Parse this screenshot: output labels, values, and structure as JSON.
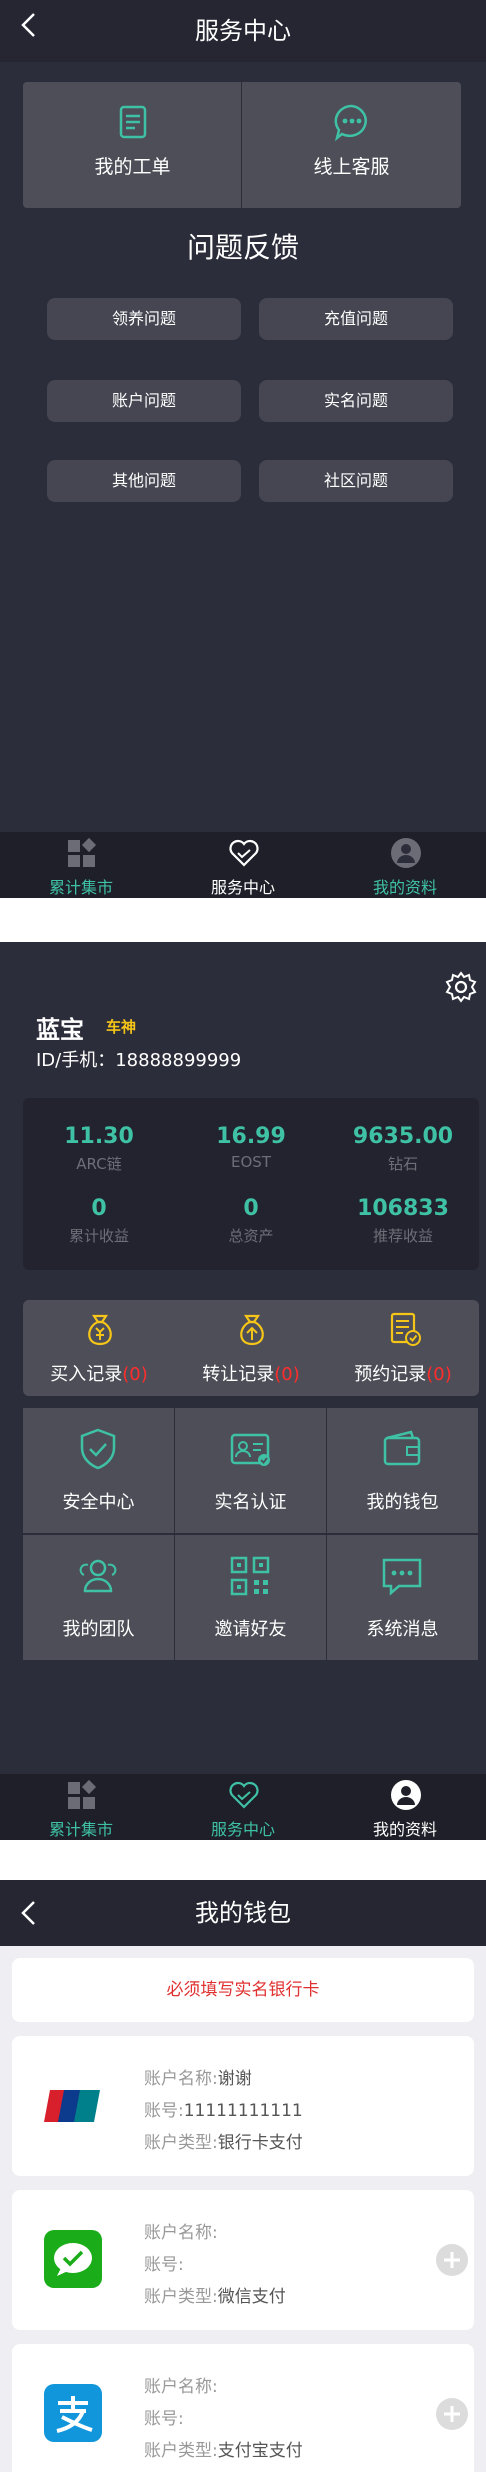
{
  "service_center": {
    "title": "服务中心",
    "quick_actions": [
      {
        "label": "我的工单",
        "icon": "ticket-icon"
      },
      {
        "label": "线上客服",
        "icon": "chat-bubble-icon"
      }
    ],
    "feedback_title": "问题反馈",
    "feedback_items": [
      "领养问题",
      "充值问题",
      "账户问题",
      "实名问题",
      "其他问题",
      "社区问题"
    ]
  },
  "tabbar": {
    "tabs": [
      {
        "label": "累计集市",
        "icon": "market-icon"
      },
      {
        "label": "服务中心",
        "icon": "heart-service-icon"
      },
      {
        "label": "我的资料",
        "icon": "user-icon"
      }
    ],
    "colors": {
      "active": "#ffffff",
      "inactive": "#3fc1a5"
    }
  },
  "profile": {
    "name": "蓝宝",
    "rank": "车神",
    "id_phone": "ID/手机：18888899999",
    "stats": [
      {
        "value": "11.30",
        "label": "ARC链"
      },
      {
        "value": "16.99",
        "label": "EOST"
      },
      {
        "value": "9635.00",
        "label": "钻石"
      },
      {
        "value": "0",
        "label": "累计收益"
      },
      {
        "value": "0",
        "label": "总资产"
      },
      {
        "value": "106833",
        "label": "推荐收益"
      }
    ],
    "records": [
      {
        "label": "买入记录",
        "count": "(0)",
        "icon": "money-bag-icon"
      },
      {
        "label": "转让记录",
        "count": "(0)",
        "icon": "money-bag-upload-icon"
      },
      {
        "label": "预约记录",
        "count": "(0)",
        "icon": "clipboard-check-icon"
      }
    ],
    "menu": [
      {
        "label": "安全中心",
        "icon": "shield-check-icon"
      },
      {
        "label": "实名认证",
        "icon": "id-card-icon"
      },
      {
        "label": "我的钱包",
        "icon": "wallet-icon"
      },
      {
        "label": "我的团队",
        "icon": "team-icon"
      },
      {
        "label": "邀请好友",
        "icon": "qr-code-icon"
      },
      {
        "label": "系统消息",
        "icon": "message-icon"
      }
    ],
    "accent_color": "#3fc1a5"
  },
  "wallet": {
    "title": "我的钱包",
    "notice": "必须填写实名银行卡",
    "accounts": [
      {
        "icon": "unionpay-logo",
        "name_label": "账户名称:",
        "name": "谢谢",
        "number_label": "账号:",
        "number": "11111111111",
        "type_label": "账户类型:",
        "type": "银行卡支付"
      },
      {
        "icon": "wechat-pay-logo",
        "name_label": "账户名称:",
        "name": "",
        "number_label": "账号:",
        "number": "",
        "type_label": "账户类型:",
        "type": "微信支付"
      },
      {
        "icon": "alipay-logo",
        "name_label": "账户名称:",
        "name": "",
        "number_label": "账号:",
        "number": "",
        "type_label": "账户类型:",
        "type": "支付宝支付"
      }
    ]
  }
}
